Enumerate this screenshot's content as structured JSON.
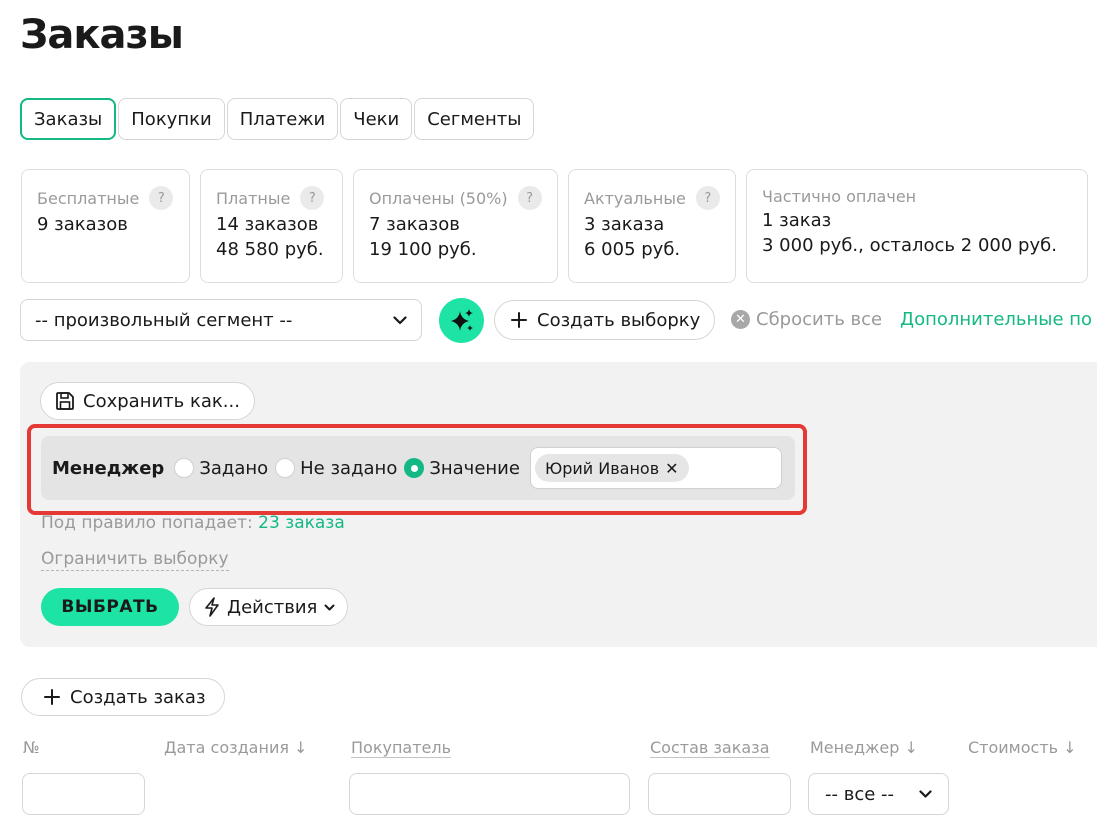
{
  "page": {
    "title": "Заказы"
  },
  "tabs": [
    {
      "label": "Заказы",
      "active": true
    },
    {
      "label": "Покупки",
      "active": false
    },
    {
      "label": "Платежи",
      "active": false
    },
    {
      "label": "Чеки",
      "active": false
    },
    {
      "label": "Сегменты",
      "active": false
    }
  ],
  "stats": [
    {
      "title": "Бесплатные",
      "help": "?",
      "line1": "9 заказов",
      "line2": ""
    },
    {
      "title": "Платные",
      "help": "?",
      "line1": "14 заказов",
      "line2": "48 580 руб."
    },
    {
      "title": "Оплачены (50%)",
      "help": "?",
      "line1": "7 заказов",
      "line2": "19 100 руб."
    },
    {
      "title": "Актуальные",
      "help": "?",
      "line1": "3 заказа",
      "line2": "6 005 руб."
    },
    {
      "title": "Частично оплачен",
      "line1": "1 заказ",
      "line2": "3 000 руб., осталось 2 000 руб."
    }
  ],
  "segment": {
    "selected": "-- произвольный сегмент --"
  },
  "toolbar": {
    "create_selection": "Создать выборку",
    "reset_all": "Сбросить все",
    "more_fields": "Дополнительные по"
  },
  "filter": {
    "save_as": "Сохранить как...",
    "rule": {
      "label": "Менеджер",
      "options": [
        {
          "label": "Задано",
          "checked": false
        },
        {
          "label": "Не задано",
          "checked": false
        },
        {
          "label": "Значение",
          "checked": true
        }
      ],
      "chips": [
        "Юрий Иванов"
      ]
    },
    "match_prefix": "Под правило попадает:",
    "match_link": "23 заказа",
    "limit": "Ограничить выборку",
    "select_button": "ВЫБРАТЬ",
    "actions_button": "Действия"
  },
  "orders": {
    "create_button": "Создать заказ",
    "columns": {
      "number": "№",
      "created": "Дата создания ↓",
      "buyer": "Покупатель",
      "items": "Состав заказа",
      "manager": "Менеджер ↓",
      "cost": "Стоимость ↓"
    },
    "manager_filter": "-- все --"
  },
  "colors": {
    "accent": "#1de3a4",
    "accent_text": "#14b884",
    "highlight": "#e53935",
    "panel": "#f2f2f2"
  }
}
